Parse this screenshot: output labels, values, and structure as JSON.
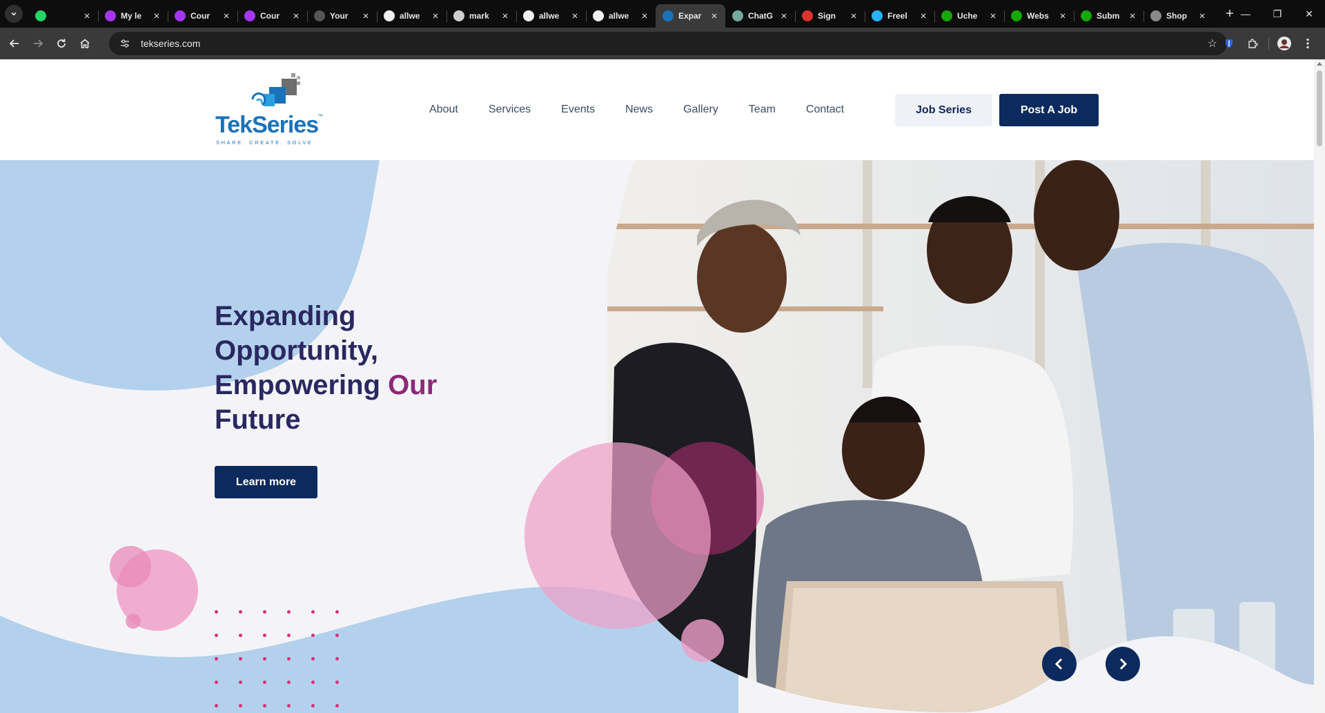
{
  "browser": {
    "tabs": [
      {
        "title": "",
        "favicon": "whatsapp-icon",
        "color": "#25d366",
        "active": false
      },
      {
        "title": "My le",
        "favicon": "udemy-icon",
        "color": "#a435f0",
        "active": false
      },
      {
        "title": "Cour",
        "favicon": "udemy-icon",
        "color": "#a435f0",
        "active": false
      },
      {
        "title": "Cour",
        "favicon": "udemy-icon",
        "color": "#a435f0",
        "active": false
      },
      {
        "title": "Your",
        "favicon": "github-icon",
        "color": "#555555",
        "active": false
      },
      {
        "title": "allwe",
        "favicon": "github-icon",
        "color": "#f0f0f0",
        "active": false
      },
      {
        "title": "mark",
        "favicon": "globe-icon",
        "color": "#d0d0d0",
        "active": false
      },
      {
        "title": "allwe",
        "favicon": "github-icon",
        "color": "#f0f0f0",
        "active": false
      },
      {
        "title": "allwe",
        "favicon": "github-icon",
        "color": "#f0f0f0",
        "active": false
      },
      {
        "title": "Expar",
        "favicon": "tekseries-icon",
        "color": "#1a72b8",
        "active": true
      },
      {
        "title": "ChatG",
        "favicon": "chatgpt-icon",
        "color": "#74aa9c",
        "active": false
      },
      {
        "title": "Sign",
        "favicon": "sign-icon",
        "color": "#e03030",
        "active": false
      },
      {
        "title": "Freel",
        "favicon": "freelancer-icon",
        "color": "#29b2fe",
        "active": false
      },
      {
        "title": "Uche",
        "favicon": "upwork-icon",
        "color": "#14a800",
        "active": false
      },
      {
        "title": "Webs",
        "favicon": "upwork-icon",
        "color": "#14a800",
        "active": false
      },
      {
        "title": "Subm",
        "favicon": "upwork-icon",
        "color": "#14a800",
        "active": false
      },
      {
        "title": "Shop",
        "favicon": "shop-icon",
        "color": "#888888",
        "active": false
      }
    ],
    "url": "tekseries.com"
  },
  "site": {
    "logo": {
      "name": "TekSeries",
      "tm": "™",
      "tagline": "SHARE. CREATE. SOLVE"
    },
    "nav": [
      "About",
      "Services",
      "Events",
      "News",
      "Gallery",
      "Team",
      "Contact"
    ],
    "buttons": {
      "job_series": "Job Series",
      "post_job": "Post A Job"
    }
  },
  "hero": {
    "title_line1": "Expanding",
    "title_line2": "Opportunity,",
    "title_line3a": "Empowering ",
    "title_line3b": "Our",
    "title_line4": "Future",
    "cta": "Learn more"
  },
  "colors": {
    "primary": "#0d2a5e",
    "accent": "#8b2a77",
    "pink": "#d8307a",
    "blue_blob": "#b3d1ec"
  }
}
